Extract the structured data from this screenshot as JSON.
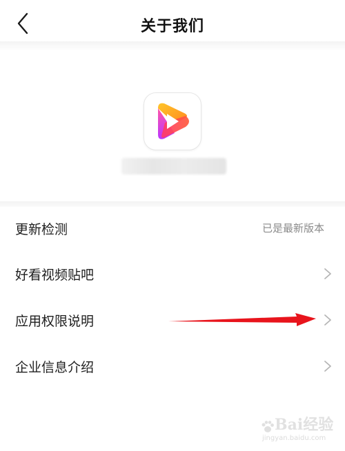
{
  "header": {
    "title": "关于我们",
    "back_icon": "chevron-left-icon"
  },
  "app": {
    "logo_icon": "play-logo-icon",
    "logo_colors": [
      "#ffb020",
      "#ff3d6e",
      "#c42cff"
    ]
  },
  "menu": {
    "items": [
      {
        "label": "更新检测",
        "value": "已是最新版本",
        "icon": null
      },
      {
        "label": "好看视频贴吧",
        "value": null,
        "icon": "chevron-right-icon"
      },
      {
        "label": "应用权限说明",
        "value": null,
        "icon": "chevron-right-icon"
      },
      {
        "label": "企业信息介绍",
        "value": null,
        "icon": "chevron-right-icon"
      }
    ]
  },
  "annotation": {
    "arrow_color": "#e8141c",
    "arrow_icon": "red-arrow-icon"
  },
  "watermark": {
    "brand": "Bai经验",
    "url": "jingyan.baidu.com"
  }
}
